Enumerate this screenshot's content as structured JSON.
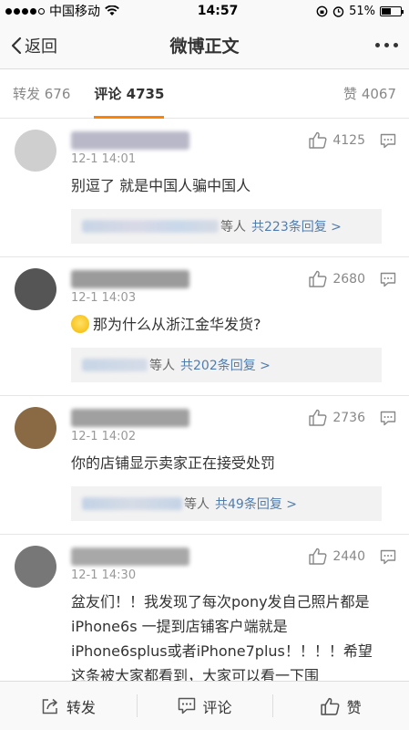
{
  "status_bar": {
    "carrier": "中国移动",
    "time": "14:57",
    "battery": "51%",
    "battery_level": 0.51
  },
  "nav": {
    "back_label": "返回",
    "title": "微博正文"
  },
  "tabs": [
    {
      "label": "转发 676"
    },
    {
      "label": "评论 4735"
    },
    {
      "label": "赞 4067"
    }
  ],
  "comments": [
    {
      "time": "12-1 14:01",
      "likes": "4125",
      "text": "别逗了 就是中国人骗中国人",
      "reply_suffix": "等人",
      "reply_link": "共223条回复 >",
      "avatar_color": "#cfcfcf",
      "name_color": "#b8b8c8"
    },
    {
      "time": "12-1 14:03",
      "likes": "2680",
      "text": "那为什么从浙江金华发货?",
      "reply_suffix": "等人",
      "reply_link": "共202条回复 >",
      "avatar_color": "#555555",
      "name_color": "#9b9b9b"
    },
    {
      "time": "12-1 14:02",
      "likes": "2736",
      "text": "你的店铺显示卖家正在接受处罚",
      "reply_suffix": "等人",
      "reply_link": "共49条回复 >",
      "avatar_color": "#8a6a45",
      "name_color": "#a0a0a0"
    },
    {
      "time": "12-1 14:30",
      "likes": "2440",
      "text": "盆友们！！我发现了每次pony发自己照片都是iPhone6s 一提到店铺客户端就是iPhone6splus或者iPhone7plus！！！！希望这条被大家都看到，大家可以看一下围",
      "avatar_color": "#777777",
      "name_color": "#a8a8a8"
    }
  ],
  "toolbar": {
    "repost": "转发",
    "comment": "评论",
    "like": "赞"
  },
  "colors": {
    "accent": "#ff8200",
    "link": "#507daf"
  }
}
